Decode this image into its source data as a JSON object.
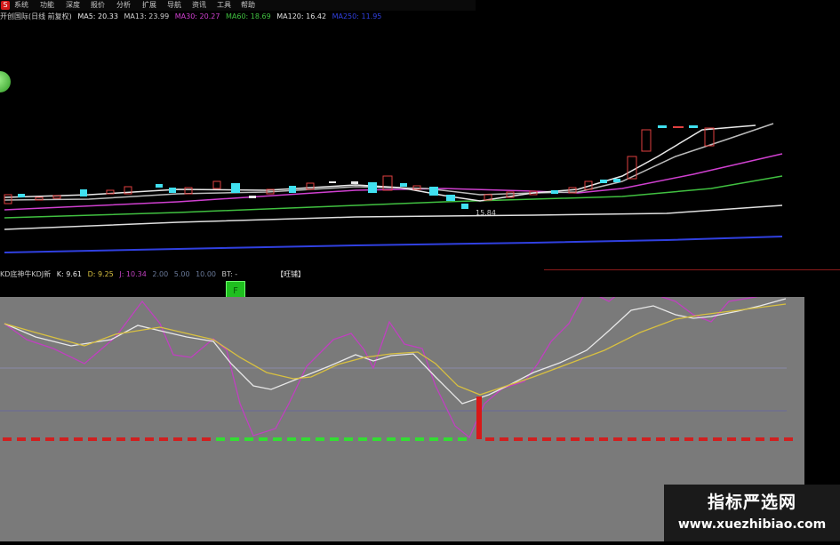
{
  "app": {
    "logo": "S"
  },
  "menu": [
    "系统",
    "功能",
    "深度",
    "报价",
    "分析",
    "扩展",
    "导航",
    "资讯",
    "工具",
    "帮助"
  ],
  "info": {
    "stock": "开创国际(日线 前复权)",
    "ma5": "MA5: 20.33",
    "ma13": "MA13: 23.99",
    "ma30": "MA30: 20.27",
    "ma60": "MA60: 18.69",
    "ma120": "MA120: 16.42",
    "ma250": "MA250: 11.95"
  },
  "colors": {
    "ma5": "#e8e8e8",
    "ma13": "#d0d0d0",
    "ma30": "#d040d0",
    "ma60": "#40c040",
    "ma120": "#e0e0e0",
    "ma250": "#3040e0",
    "up": "#e04040",
    "down": "#40e0f0",
    "k": "#e8e8e8",
    "d": "#d8c040",
    "j": "#c040c0"
  },
  "chart": {
    "low_label": "15.84"
  },
  "indicator": {
    "title": "KD底神牛KDJ新",
    "k": "K: 9.61",
    "d": "D: 9.25",
    "j": "J: 10.34",
    "p1": "2.00",
    "p2": "5.00",
    "p3": "10.00",
    "bt": "BT: -",
    "tag": "【旺铺】",
    "green_label": "F"
  },
  "watermark": {
    "title": "指标严选网",
    "url": "www.xuezhibiao.com"
  }
}
